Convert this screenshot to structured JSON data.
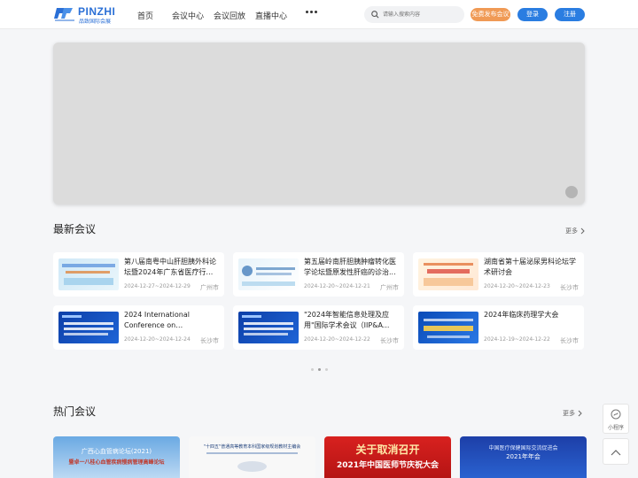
{
  "brand": {
    "name": "PINZHI",
    "subtitle": "品致国际会展"
  },
  "nav": [
    {
      "label": "首页"
    },
    {
      "label": "会议中心"
    },
    {
      "label": "会议回放"
    },
    {
      "label": "直播中心"
    }
  ],
  "search": {
    "placeholder": "请输入搜索内容"
  },
  "header_buttons": {
    "publish": "免费发布会议",
    "login": "登录",
    "register": "注册"
  },
  "colors": {
    "primary": "#2a7de1",
    "publish": "#f09a55"
  },
  "latest": {
    "title": "最新会议",
    "more": "更多",
    "items": [
      {
        "title": "第八届南粤中山肝胆胰外科论坛暨2024年广东省医疗行业协会...",
        "date": "2024-12-27~2024-12-29",
        "city": "广州市"
      },
      {
        "title": "第五届岭南肝胆胰肿瘤转化医学论坛暨原发性肝癌的诊治...",
        "date": "2024-12-20~2024-12-21",
        "city": "广州市"
      },
      {
        "title": "湖南省第十届泌尿男科论坛学术研讨会",
        "date": "2024-12-20~2024-12-23",
        "city": "长沙市"
      },
      {
        "title": "2024 International Conference on Intelligent...",
        "date": "2024-12-20~2024-12-24",
        "city": "长沙市"
      },
      {
        "title": "\"2024年智能信息处理及应用\"国际学术会议（IIP&A...",
        "date": "2024-12-20~2024-12-22",
        "city": "长沙市"
      },
      {
        "title": "2024年临床药理学大会",
        "date": "2024-12-19~2024-12-22",
        "city": "长沙市"
      }
    ]
  },
  "hot": {
    "title": "热门会议",
    "more": "更多",
    "banners": [
      {
        "line1": "广西心血管病论坛(2021)",
        "line2": "暨卓一八桂心血管疾病慢病管理高峰论坛"
      },
      {
        "line1": "\"十四五\"普通高等教育本科国家级规划教材主编会",
        "line2": ""
      },
      {
        "line1": "关于取消召开",
        "line2": "2021年中国医师节庆祝大会"
      },
      {
        "line1": "中国医疗保健国际交流促进会",
        "line2": "2021年年会"
      }
    ]
  },
  "side": {
    "mini_program": "小程序"
  }
}
